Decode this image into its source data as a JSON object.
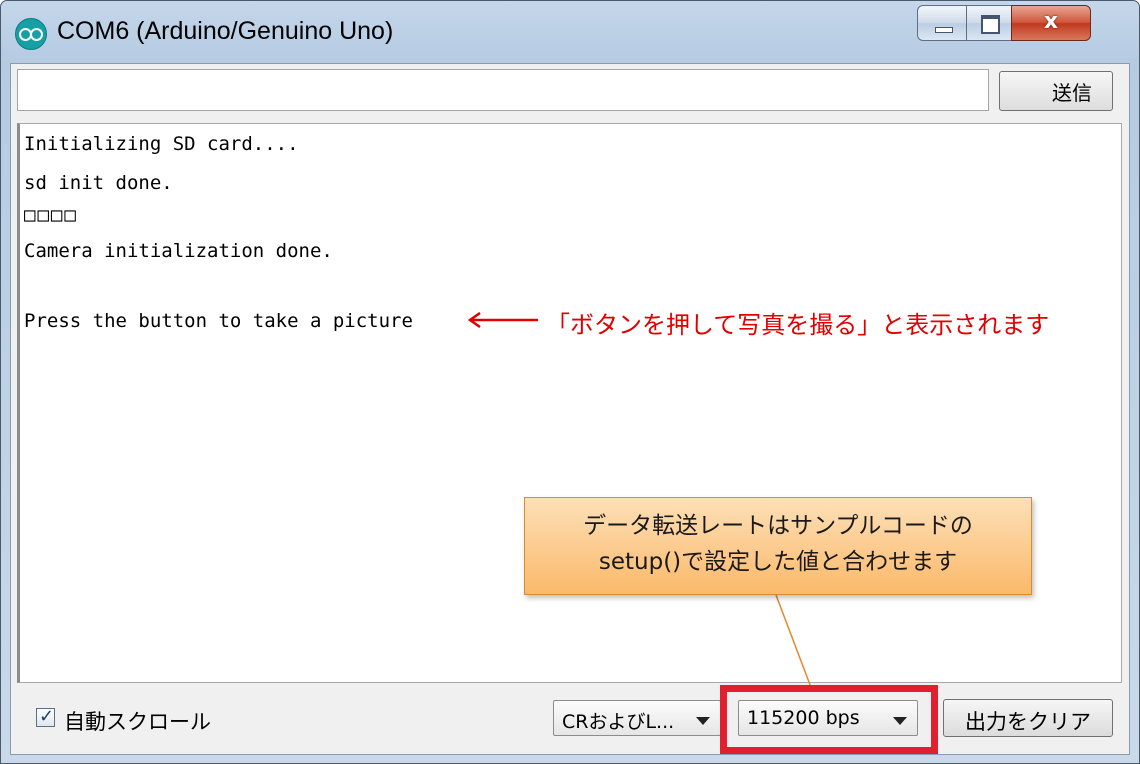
{
  "window": {
    "title": "COM6 (Arduino/Genuino Uno)",
    "close_glyph": "x"
  },
  "send": {
    "input_value": "",
    "button_label": "送信"
  },
  "output": {
    "lines": [
      "Initializing SD card....",
      "sd init done.",
      "□□□□",
      "Camera initialization done.",
      "",
      "Press the button to take a picture"
    ]
  },
  "annotations": {
    "red_note": "「ボタンを押して写真を撮る」と表示されます",
    "red_color": "#e00000",
    "callout_line1": "データ転送レートはサンプルコードの",
    "callout_line2": "setup()で設定した値と合わせます",
    "highlight_color": "#e0202f"
  },
  "bottom_bar": {
    "autoscroll_label": "自動スクロール",
    "autoscroll_checked": true,
    "line_ending_value": "CRおよびL...",
    "baud_value": "115200 bps",
    "clear_button_label": "出力をクリア"
  },
  "icons": {
    "app": "arduino-logo-icon",
    "minimize": "minimize-icon",
    "maximize": "maximize-icon",
    "close": "close-icon",
    "arrow": "left-arrow-icon",
    "dropdown": "chevron-down-icon"
  }
}
